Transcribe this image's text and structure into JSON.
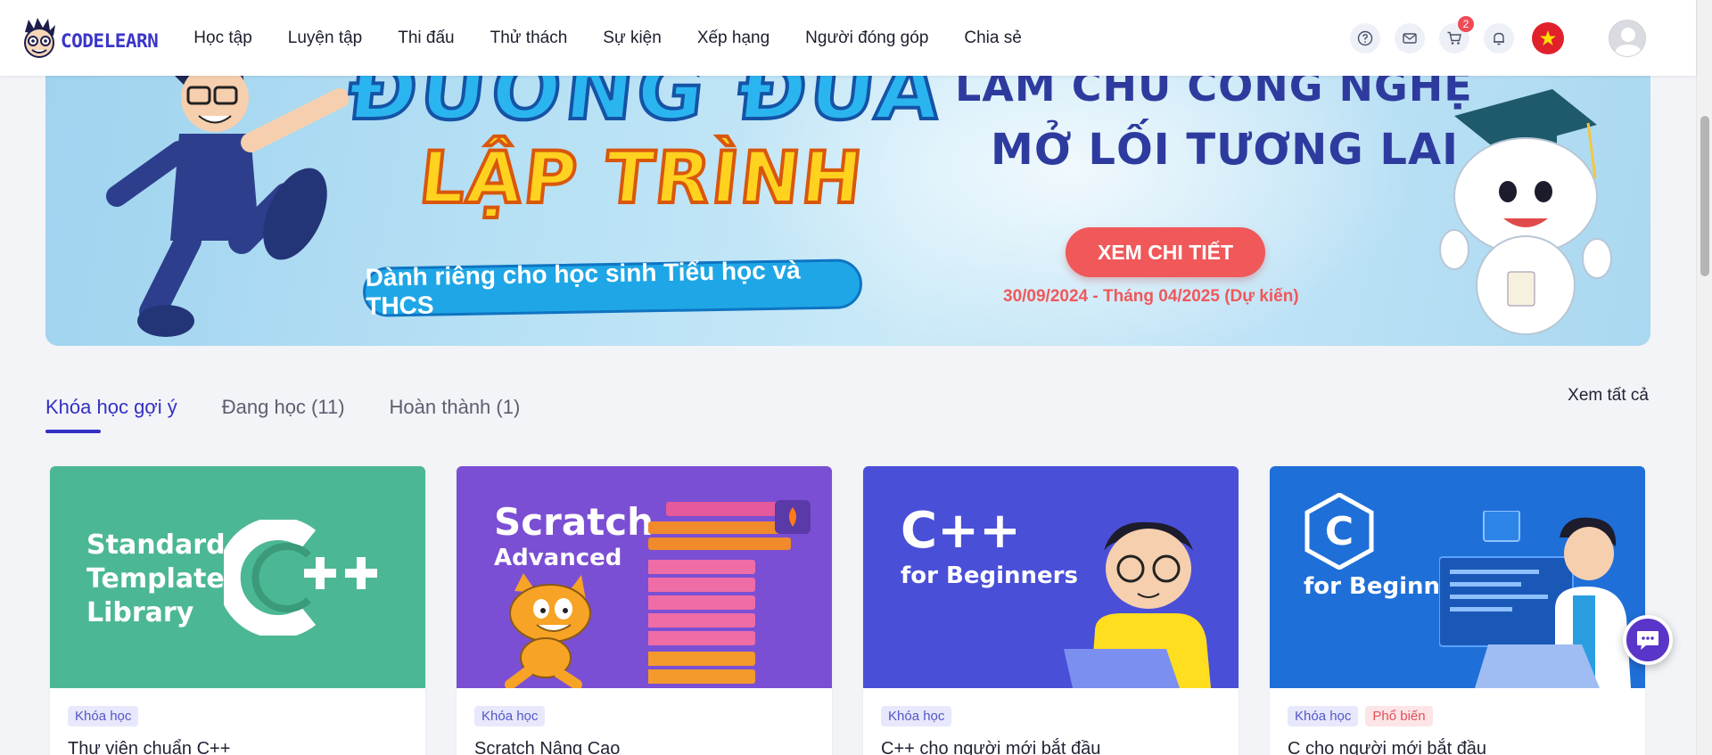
{
  "brand": {
    "logo_text": "CODELEARN"
  },
  "nav": {
    "items": [
      "Học tập",
      "Luyện tập",
      "Thi đấu",
      "Thử thách",
      "Sự kiện",
      "Xếp hạng",
      "Người đóng góp",
      "Chia sẻ"
    ]
  },
  "header_icons": {
    "help": "question-circle-icon",
    "messages": "mail-icon",
    "cart": "cart-icon",
    "cart_count": "2",
    "notifications": "bell-icon",
    "language": "vietnam-flag-icon",
    "account": "user-avatar"
  },
  "banner": {
    "headline_top": "ĐƯỜNG ĐUA",
    "headline_main": "LẬP TRÌNH",
    "subtitle": "Dành riêng cho học sinh Tiểu học và THCS",
    "slogan_line1": "LÀM CHỦ CÔNG NGHỆ",
    "slogan_line2": "MỞ LỐI TƯƠNG LAI",
    "cta_label": "XEM CHI TIẾT",
    "dates": "30/09/2024 - Tháng 04/2025 (Dự kiến)"
  },
  "tabs": {
    "suggested": "Khóa học gợi ý",
    "in_progress": "Đang học (11)",
    "completed": "Hoàn thành (1)",
    "see_all": "Xem tất cả"
  },
  "cards": [
    {
      "tag": "Khóa học",
      "title": "Thư viện chuẩn C++",
      "image": {
        "line1": "Standard",
        "line2": "Template",
        "line3": "Library",
        "logo": "C++"
      },
      "color": "#4cb795"
    },
    {
      "tag": "Khóa học",
      "title": "Scratch Nâng Cao",
      "image": {
        "line1": "Scratch",
        "line2": "Advanced"
      },
      "color": "#7b4fd3"
    },
    {
      "tag": "Khóa học",
      "title": "C++ cho người mới bắt đầu",
      "image": {
        "line1": "C++",
        "line2": "for Beginners"
      },
      "color": "#4a4fd8"
    },
    {
      "tag": "Khóa học",
      "tag2": "Phổ biến",
      "title": "C cho người mới bắt đầu",
      "image": {
        "line1": "C",
        "line2": "for Beginners"
      },
      "color": "#1f6fd8"
    }
  ],
  "chat": {
    "icon": "chat-bubble-icon"
  }
}
